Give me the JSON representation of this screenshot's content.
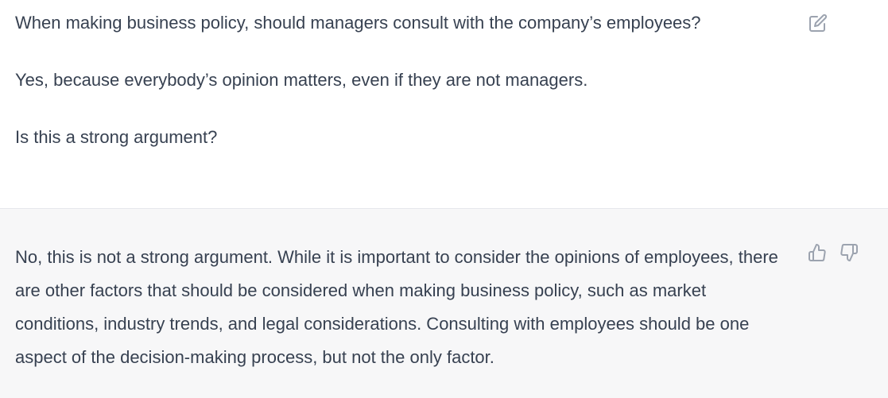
{
  "conversation": {
    "user_message": {
      "paragraphs": [
        "When making business policy, should managers consult with the company’s employees?",
        "Yes, because everybody’s opinion matters, even if they are not managers.",
        "Is this a strong argument?"
      ],
      "edit_icon": "edit-icon"
    },
    "assistant_message": {
      "text": "No, this is not a strong argument. While it is important to consider the opinions of employees, there are other factors that should be considered when making business policy, such as market conditions, industry trends, and legal considerations. Consulting with employees should be one aspect of the decision-making process, but not the only factor.",
      "thumbs_up_icon": "thumbs-up-icon",
      "thumbs_down_icon": "thumbs-down-icon"
    }
  },
  "colors": {
    "user_bg": "#ffffff",
    "assistant_bg": "#f7f7f8",
    "text": "#374151",
    "icon": "#9ca3af",
    "divider": "#e5e7eb"
  }
}
